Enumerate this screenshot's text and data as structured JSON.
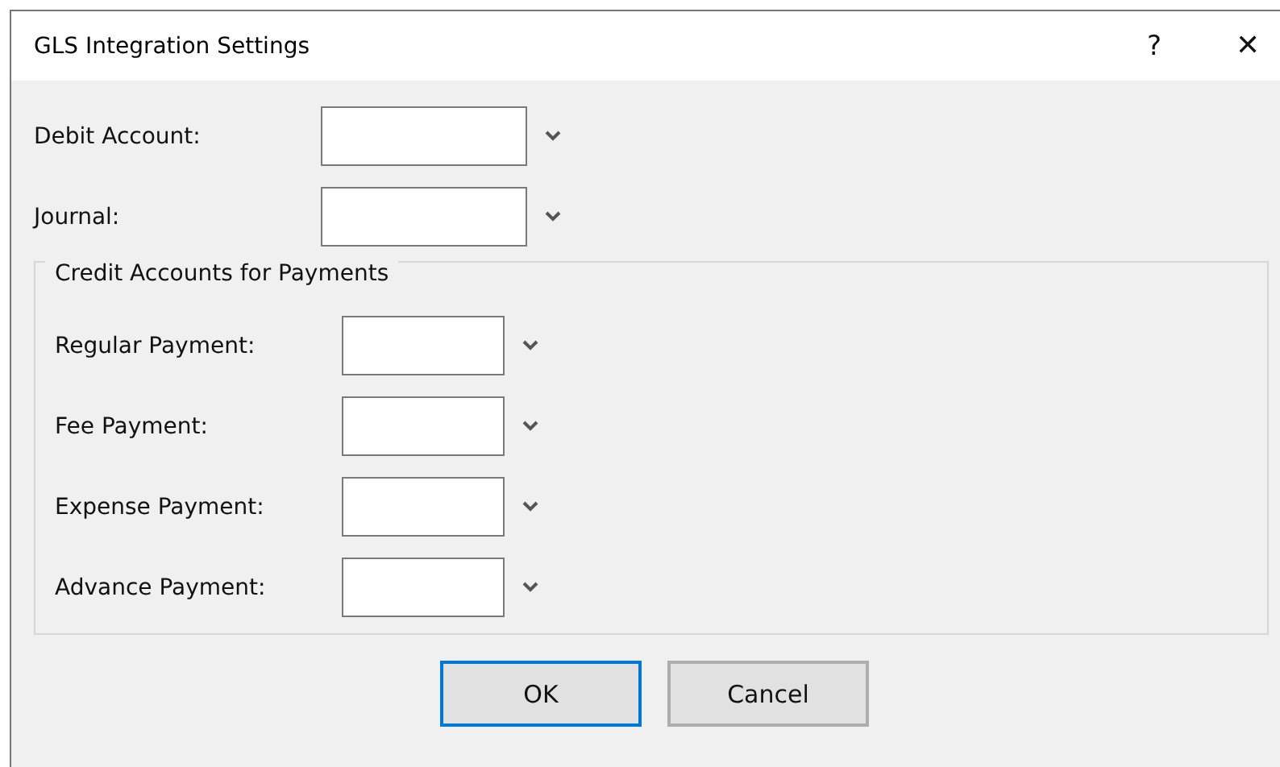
{
  "window": {
    "title": "GLS Integration Settings",
    "help": "?",
    "close": "✕"
  },
  "fields": [
    {
      "label": "Debit Account:"
    },
    {
      "label": "Journal:"
    }
  ],
  "group": {
    "title": "Credit Accounts for Payments",
    "fields": [
      {
        "label": "Regular Payment:"
      },
      {
        "label": "Fee Payment:"
      },
      {
        "label": "Expense Payment:"
      },
      {
        "label": "Advance Payment:"
      }
    ]
  },
  "buttons": [
    {
      "label": "OK",
      "focused": true
    },
    {
      "label": "Cancel",
      "focused": false
    }
  ]
}
